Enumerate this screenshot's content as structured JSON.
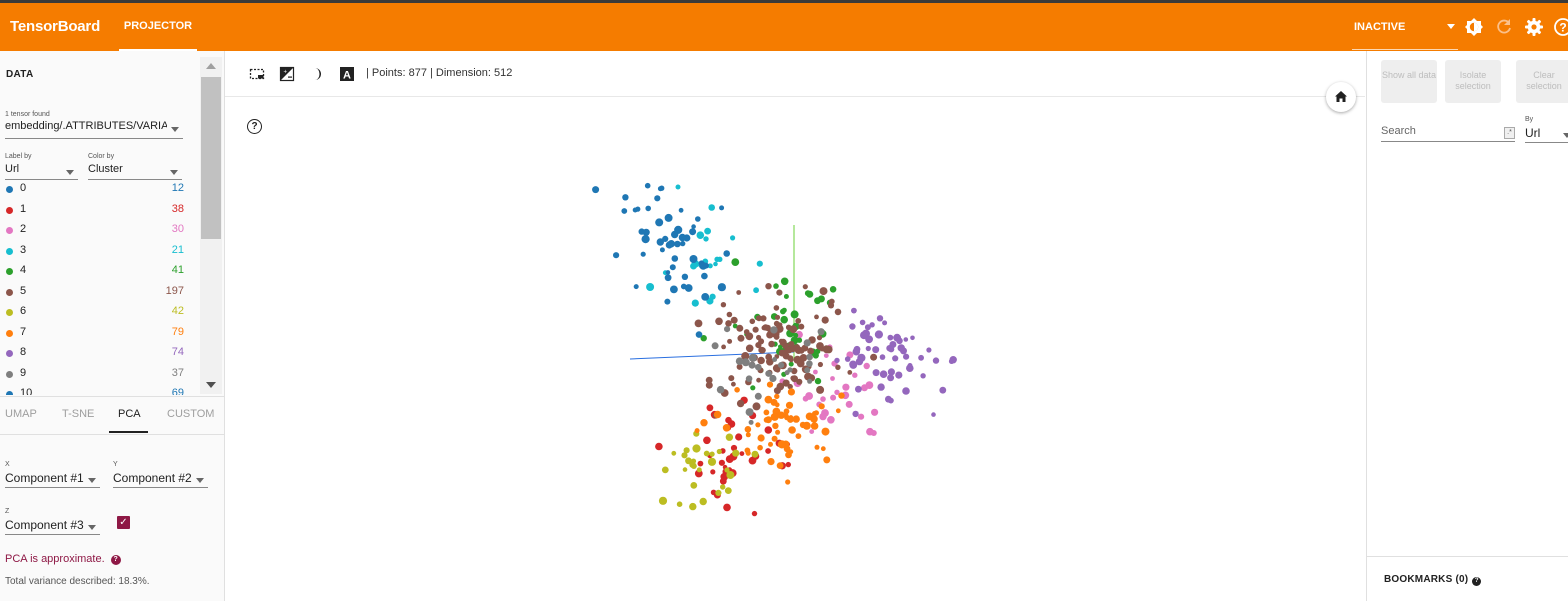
{
  "header": {
    "brand": "TensorBoard",
    "active_tab": "PROJECTOR",
    "run_status": "INACTIVE",
    "icons": [
      "brightness-icon",
      "refresh-icon",
      "settings-icon",
      "help-icon"
    ]
  },
  "left_panel": {
    "title": "DATA",
    "tensors_found": "1 tensor found",
    "tensor_name": "embedding/.ATTRIBUTES/VARIA",
    "label_by": {
      "label": "Label by",
      "value": "Url"
    },
    "color_by": {
      "label": "Color by",
      "value": "Cluster"
    },
    "legend": [
      {
        "label": "0",
        "count": "12",
        "color": "#1f77b4"
      },
      {
        "label": "1",
        "count": "38",
        "color": "#d62728"
      },
      {
        "label": "2",
        "count": "30",
        "color": "#e377c2"
      },
      {
        "label": "3",
        "count": "21",
        "color": "#17becf"
      },
      {
        "label": "4",
        "count": "41",
        "color": "#2ca02c"
      },
      {
        "label": "5",
        "count": "197",
        "color": "#8c564b"
      },
      {
        "label": "6",
        "count": "42",
        "color": "#bcbd22"
      },
      {
        "label": "7",
        "count": "79",
        "color": "#ff7f0e"
      },
      {
        "label": "8",
        "count": "74",
        "color": "#9467bd"
      },
      {
        "label": "9",
        "count": "37",
        "color": "#7f7f7f"
      },
      {
        "label": "10",
        "count": "69",
        "color": "#1f77b4"
      }
    ],
    "projection_tabs": [
      "UMAP",
      "T-SNE",
      "PCA",
      "CUSTOM"
    ],
    "active_projection": "PCA",
    "x_axis": {
      "label": "X",
      "value": "Component #1"
    },
    "y_axis": {
      "label": "Y",
      "value": "Component #2"
    },
    "z_axis": {
      "label": "Z",
      "value": "Component #3",
      "enabled": true
    },
    "pca_note": "PCA is approximate.",
    "variance": "Total variance described: 18.3%."
  },
  "center": {
    "toolbar_icons": [
      "select-rectangle-icon",
      "night-mode-icon",
      "moon-icon",
      "label-toggle-icon"
    ],
    "points_info": "| Points: 877 | Dimension: 512",
    "home_icon": "home-icon",
    "help_symbol": "?"
  },
  "right_panel": {
    "buttons": [
      "Show all data",
      "Isolate selection",
      "Clear selection"
    ],
    "search_placeholder": "Search",
    "regex_symbol": ".*",
    "by_label": "By",
    "by_value": "Url",
    "bookmarks": "BOOKMARKS (0)"
  }
}
